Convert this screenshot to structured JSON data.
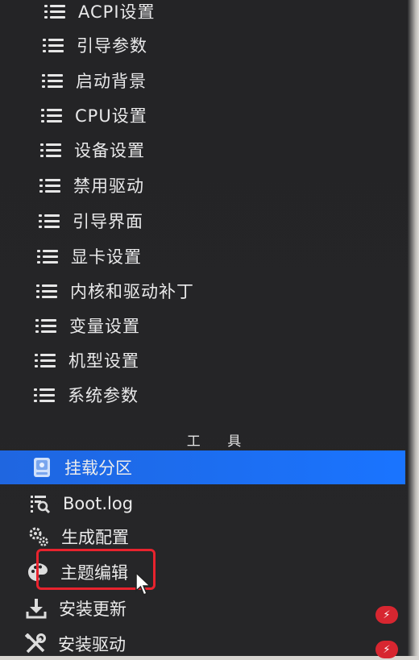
{
  "menu": {
    "items": [
      {
        "label": "ACPI设置"
      },
      {
        "label": "引导参数"
      },
      {
        "label": "启动背景"
      },
      {
        "label": "CPU设置"
      },
      {
        "label": "设备设置"
      },
      {
        "label": "禁用驱动"
      },
      {
        "label": "引导界面"
      },
      {
        "label": "显卡设置"
      },
      {
        "label": "内核和驱动补丁"
      },
      {
        "label": "变量设置"
      },
      {
        "label": "机型设置"
      },
      {
        "label": "系统参数"
      }
    ]
  },
  "tools": {
    "section_title": "工 具",
    "items": [
      {
        "label": "挂载分区",
        "icon": "disk-icon",
        "selected": true
      },
      {
        "label": "Boot.log",
        "icon": "log-search-icon"
      },
      {
        "label": "生成配置",
        "icon": "gears-icon"
      },
      {
        "label": "主题编辑",
        "icon": "palette-icon",
        "highlighted": true
      },
      {
        "label": "安装更新",
        "icon": "download-icon"
      },
      {
        "label": "安装驱动",
        "icon": "tools-icon"
      }
    ],
    "badge_symbol": "⚡"
  },
  "colors": {
    "background": "#242426",
    "selection": "#1a6cf0",
    "highlight_box": "#e8232e",
    "badge": "#d72630"
  }
}
